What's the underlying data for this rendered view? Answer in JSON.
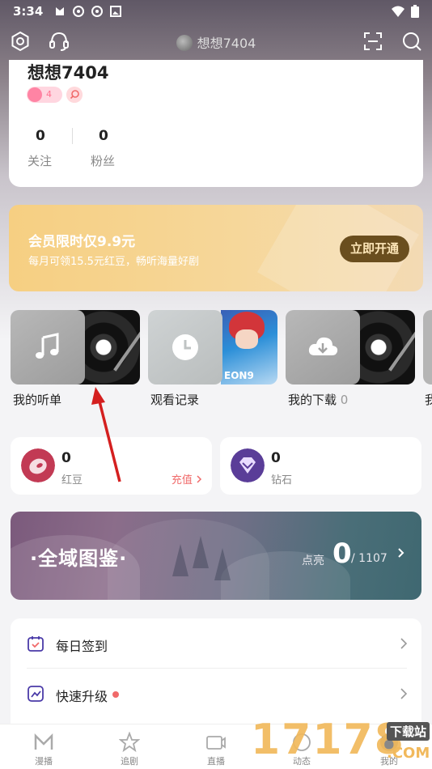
{
  "status_bar": {
    "time": "3:34"
  },
  "top_nav": {
    "username": "想想7404"
  },
  "profile": {
    "username": "想想7404",
    "level": "4",
    "following_count": "0",
    "following_label": "关注",
    "fans_count": "0",
    "fans_label": "粉丝"
  },
  "vip_banner": {
    "title": "会员限时仅9.9元",
    "subtitle": "每月可领15.5元红豆，畅听海量好剧",
    "button": "立即开通"
  },
  "quick_entries": [
    {
      "label": "我的听单",
      "count": ""
    },
    {
      "label": "观看记录",
      "count": ""
    },
    {
      "label": "我的下载",
      "count": "0"
    },
    {
      "label": "我"
    }
  ],
  "cover_art_text": "EON9",
  "wallet": {
    "red_bean_count": "0",
    "red_bean_label": "红豆",
    "recharge_link": "充值",
    "diamond_count": "0",
    "diamond_label": "钻石"
  },
  "atlas_banner": {
    "title": "·全域图鉴·",
    "light_label": "点亮",
    "lit_count": "0",
    "total": "/ 1107"
  },
  "menu": [
    {
      "label": "每日签到"
    },
    {
      "label": "快速升级"
    }
  ],
  "tabs": [
    {
      "label": "漫播"
    },
    {
      "label": "追剧"
    },
    {
      "label": "直播"
    },
    {
      "label": "动态"
    },
    {
      "label": "我的"
    }
  ],
  "watermark": {
    "digits": "17178",
    "site": "下载站",
    "domain": ".COM"
  },
  "colors": {
    "accent_red": "#f06a6a",
    "vip_gold": "#f6cf82",
    "vip_button": "#6a4e1e",
    "arrow_annotation": "#d41f1f"
  }
}
